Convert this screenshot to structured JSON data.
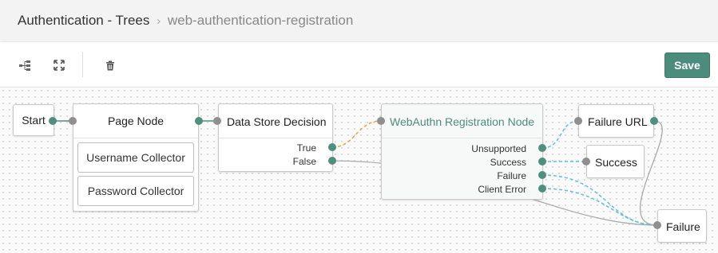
{
  "breadcrumb": {
    "root": "Authentication - Trees",
    "separator": "›",
    "current": "web-authentication-registration"
  },
  "toolbar": {
    "icons": [
      "tree-layout-icon",
      "fullscreen-icon",
      "trash-icon"
    ],
    "save_label": "Save",
    "save_color": "#4c8c7c"
  },
  "nodes": {
    "start": {
      "title": "Start"
    },
    "page_node": {
      "title": "Page Node",
      "children": [
        "Username Collector",
        "Password Collector"
      ]
    },
    "data_store": {
      "title": "Data Store Decision",
      "outcomes": [
        "True",
        "False"
      ]
    },
    "webauthn": {
      "title": "WebAuthn Registration Node",
      "title_color": "#4c8c7c",
      "outcomes": [
        "Unsupported",
        "Success",
        "Failure",
        "Client Error"
      ]
    },
    "failure_url": {
      "title": "Failure URL"
    },
    "success": {
      "title": "Success"
    },
    "failure": {
      "title": "Failure"
    }
  },
  "colors": {
    "connector_gray": "#aaaaaa",
    "connector_orange": "#f0a040",
    "connector_blue": "#5bc0de",
    "port_out": "#4f8f7d",
    "port_in": "#8f8f8f"
  }
}
